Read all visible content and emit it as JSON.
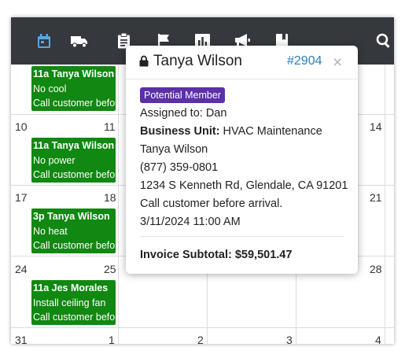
{
  "colors": {
    "topbar_bg": "#35383d",
    "active_icon": "#5aa7e0",
    "icon": "#ffffff",
    "event_bg": "#118811",
    "badge_bg": "#5b30a8",
    "link": "#2a80b9"
  },
  "toolbar": {
    "icons": [
      "calendar-icon",
      "truck-icon",
      "clipboard-icon",
      "flag-icon",
      "bar-chart-icon",
      "megaphone-icon",
      "book-icon",
      "search-icon"
    ],
    "active": "calendar-icon"
  },
  "calendar": {
    "day_numbers": {
      "d10": "10",
      "d11": "11",
      "d14": "14",
      "d17": "17",
      "d18": "18",
      "d21": "21",
      "d24": "24",
      "d25": "25",
      "d28": "28",
      "d31": "31",
      "n1": "1",
      "n2": "2",
      "n3": "3",
      "n4": "4"
    },
    "events": [
      {
        "title": "11a Tanya Wilson",
        "line2": "No cool",
        "line3": "Call customer before arrival."
      },
      {
        "title": "11a Tanya Wilson",
        "line2": "No power",
        "line3": "Call customer before arrival."
      },
      {
        "title": "3p Tanya Wilson",
        "line2": "No heat",
        "line3": "Call customer before arrival."
      },
      {
        "title": "11a Jes Morales",
        "line2": "Install ceiling fan",
        "line3": "Call customer before arrival."
      }
    ]
  },
  "popover": {
    "title": "Tanya Wilson",
    "job_id": "#2904",
    "close": "×",
    "badge": "Potential Member",
    "assigned": "Assigned to: Dan",
    "business_unit_label": "Business Unit:",
    "business_unit_value": "HVAC Maintenance",
    "customer_name": "Tanya Wilson",
    "phone": "(877) 359-0801",
    "address": "1234 S Kenneth Rd, Glendale, CA 91201",
    "note": "Call customer before arrival.",
    "datetime": "3/11/2024 11:00 AM",
    "subtotal_label": "Invoice Subtotal:",
    "subtotal_value": "$59,501.47"
  }
}
